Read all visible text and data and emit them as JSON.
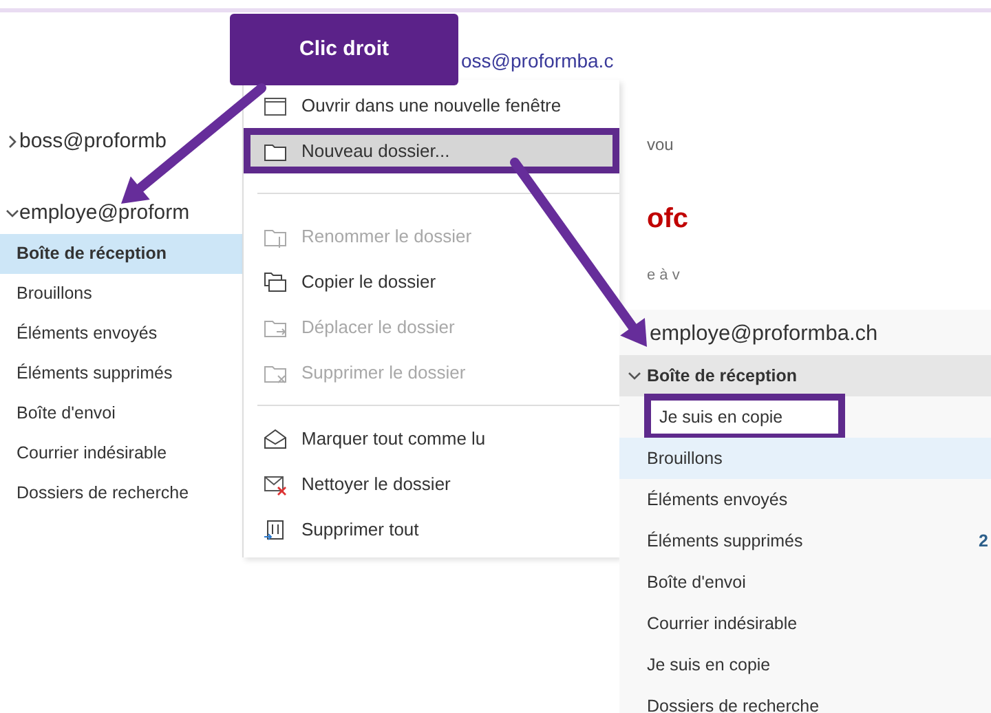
{
  "callout": {
    "text": "Clic droit"
  },
  "left_pane": {
    "accounts": [
      {
        "label": "boss@proformb",
        "expanded": false
      },
      {
        "label": "employe@proform",
        "expanded": true
      }
    ],
    "folders": [
      {
        "label": "Boîte de réception",
        "selected": true
      },
      {
        "label": "Brouillons",
        "selected": false
      },
      {
        "label": "Éléments envoyés",
        "selected": false
      },
      {
        "label": "Éléments supprimés",
        "selected": false
      },
      {
        "label": "Boîte d'envoi",
        "selected": false
      },
      {
        "label": "Courrier indésirable",
        "selected": false
      },
      {
        "label": "Dossiers de recherche",
        "selected": false
      }
    ]
  },
  "reading_pane": {
    "sender": "oss@proformba.c",
    "line_1": "vou",
    "subject": "ofc",
    "line_2": "e à v"
  },
  "context_menu": {
    "items": [
      {
        "kind": "item",
        "label": "Ouvrir dans une nouvelle fenêtre",
        "disabled": false,
        "highlighted": false
      },
      {
        "kind": "item",
        "label": "Nouveau dossier...",
        "disabled": false,
        "highlighted": true
      },
      {
        "kind": "separator"
      },
      {
        "kind": "item",
        "label": "Renommer le dossier",
        "disabled": true,
        "highlighted": false
      },
      {
        "kind": "item",
        "label": "Copier le dossier",
        "disabled": false,
        "highlighted": false
      },
      {
        "kind": "item",
        "label": "Déplacer le dossier",
        "disabled": true,
        "highlighted": false
      },
      {
        "kind": "item",
        "label": "Supprimer le dossier",
        "disabled": true,
        "highlighted": false
      },
      {
        "kind": "separator"
      },
      {
        "kind": "item",
        "label": "Marquer tout comme lu",
        "disabled": false,
        "highlighted": false
      },
      {
        "kind": "item",
        "label": "Nettoyer le dossier",
        "disabled": false,
        "highlighted": false
      },
      {
        "kind": "item",
        "label": "Supprimer tout",
        "disabled": false,
        "highlighted": false
      }
    ]
  },
  "right_pane": {
    "account": "employe@proformba.ch",
    "folders": [
      {
        "label": "Boîte de réception",
        "selected": false,
        "expanded": true,
        "children": [
          {
            "label": "Je suis en copie",
            "selected": false,
            "highlighted": true
          }
        ]
      },
      {
        "label": "Brouillons",
        "selected": true
      },
      {
        "label": "Éléments envoyés",
        "selected": false
      },
      {
        "label": "Éléments supprimés",
        "selected": false,
        "count": "2"
      },
      {
        "label": "Boîte d'envoi",
        "selected": false
      },
      {
        "label": "Courrier indésirable",
        "selected": false
      },
      {
        "label": "Je suis en copie",
        "selected": false
      },
      {
        "label": "Dossiers de recherche",
        "selected": false
      }
    ]
  }
}
